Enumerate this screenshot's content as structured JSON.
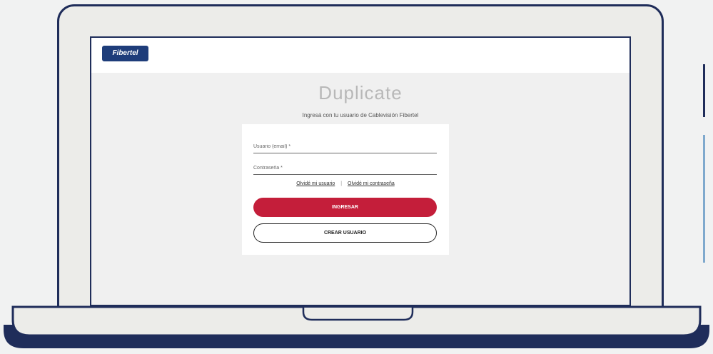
{
  "header": {
    "logo_text": "Fibertel"
  },
  "main": {
    "title": "Duplicate",
    "subtitle": "Ingresá con tu usuario de Cablevisión Fibertel"
  },
  "login_form": {
    "user_placeholder": "Usuario (email) *",
    "password_placeholder": "Contraseña *",
    "forgot_user": "Olvidé mi usuario",
    "separator": "|",
    "forgot_password": "Olvidé mi contraseña",
    "login_button": "INGRESAR",
    "create_button": "CREAR USUARIO"
  },
  "colors": {
    "primary_red": "#c41e3a",
    "brand_navy": "#1f2d5a",
    "accent_light_blue": "#7fa9cd",
    "logo_blue": "#1e3d7a"
  }
}
